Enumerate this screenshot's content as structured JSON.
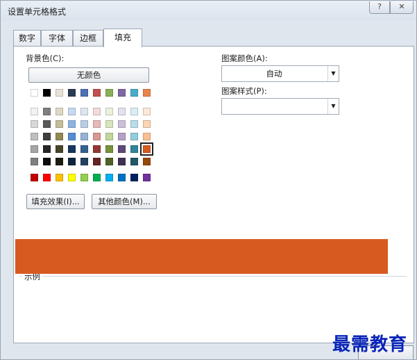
{
  "dialog": {
    "title": "设置单元格格式",
    "help_label": "?",
    "close_label": "✕"
  },
  "tabs": [
    {
      "label": "数字"
    },
    {
      "label": "字体"
    },
    {
      "label": "边框"
    },
    {
      "label": "填充"
    }
  ],
  "active_tab": "填充",
  "fill": {
    "background_color_label": "背景色(C):",
    "no_color_button": "无颜色",
    "fill_effects_button": "填充效果(I)...",
    "more_colors_button": "其他颜色(M)...",
    "pattern_color_label": "图案颜色(A):",
    "pattern_color_value": "自动",
    "pattern_style_label": "图案样式(P):",
    "pattern_style_value": "",
    "sample_label": "示例",
    "sample_color": "#D75B21",
    "selected_color": "#D75B21"
  },
  "palette": {
    "theme_row": [
      "#FFFFFF",
      "#000000",
      "#E7E2D5",
      "#2A3A55",
      "#4A72B4",
      "#C0504D",
      "#8BAE57",
      "#7F67A3",
      "#4BACC6",
      "#E8844B"
    ],
    "tints": [
      [
        "#F2F2F2",
        "#7F7F7F",
        "#DDD9C3",
        "#C6D9F1",
        "#DCE6F2",
        "#F2DCDB",
        "#EBF1DE",
        "#E5E0EC",
        "#DAEEF3",
        "#FDE9D9"
      ],
      [
        "#D8D8D8",
        "#595959",
        "#C4BD97",
        "#8DB3E2",
        "#B9CDE5",
        "#E6B9B8",
        "#D7E4BD",
        "#CCC1DA",
        "#B7DEE8",
        "#FCD5B5"
      ],
      [
        "#BFBFBF",
        "#3F3F3F",
        "#938953",
        "#548DD4",
        "#95B3D7",
        "#D99694",
        "#C3D69B",
        "#B2A2C7",
        "#93CDDD",
        "#FAC090"
      ],
      [
        "#A5A5A5",
        "#262626",
        "#494429",
        "#17365D",
        "#366092",
        "#953734",
        "#76923C",
        "#5F497A",
        "#31859B",
        "#D75B21"
      ],
      [
        "#7F7F7F",
        "#0C0C0C",
        "#1D1B10",
        "#0F243E",
        "#244061",
        "#632423",
        "#4F6128",
        "#3F3151",
        "#205867",
        "#984807"
      ]
    ],
    "standard_row": [
      "#C00000",
      "#FF0000",
      "#FFC000",
      "#FFFF00",
      "#92D050",
      "#00B050",
      "#00B0F0",
      "#0070C0",
      "#002060",
      "#7030A0"
    ]
  },
  "watermark": {
    "text": "最需教育"
  }
}
